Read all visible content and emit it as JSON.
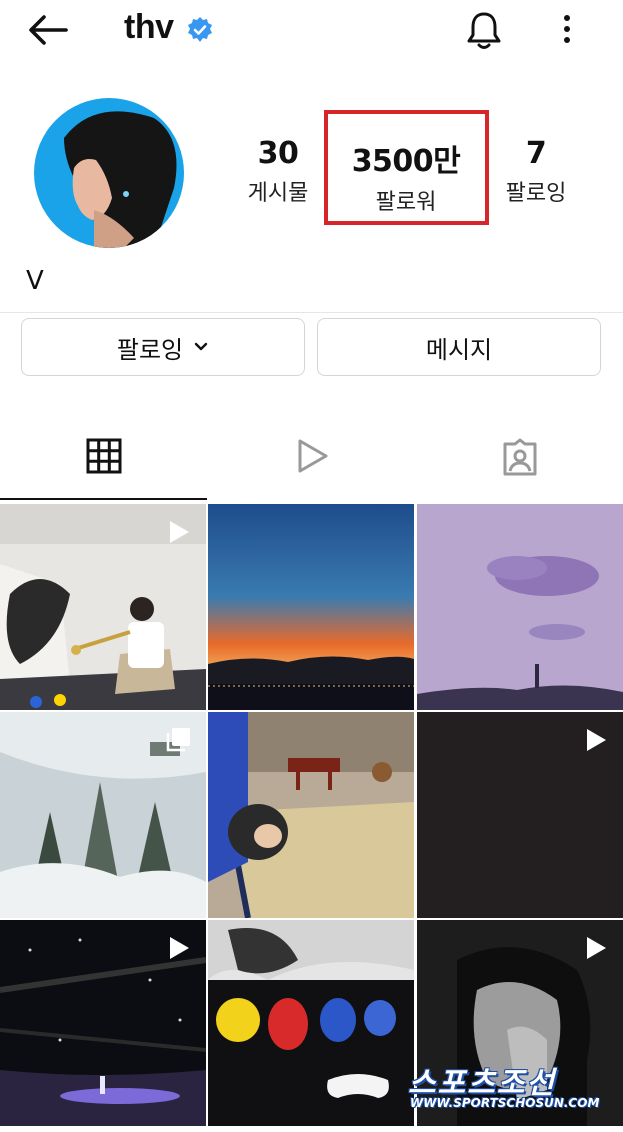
{
  "header": {
    "username": "thv",
    "back_icon": "back-arrow-icon",
    "verified_icon": "verified-badge-icon",
    "notification_icon": "bell-icon",
    "more_icon": "more-vertical-icon",
    "verified_color": "#3897f0"
  },
  "profile": {
    "display_name": "V",
    "avatar_background": "#1aa3e8",
    "stats": {
      "posts": {
        "value": "30",
        "label": "게시물"
      },
      "followers": {
        "value": "3500만",
        "label": "팔로워"
      },
      "following": {
        "value": "7",
        "label": "팔로잉"
      }
    },
    "highlight_color": "#d7262b"
  },
  "actions": {
    "follow_label": "팔로잉",
    "message_label": "메시지"
  },
  "tabs": [
    {
      "icon": "grid-icon",
      "selected": true
    },
    {
      "icon": "reels-play-icon",
      "selected": false
    },
    {
      "icon": "tagged-person-icon",
      "selected": false
    }
  ],
  "posts": [
    {
      "description": "man playing trumpet in living room",
      "badge": "video"
    },
    {
      "description": "sunset over city skyline",
      "badge": "none"
    },
    {
      "description": "purple sky with clouds",
      "badge": "none"
    },
    {
      "description": "snowy forest",
      "badge": "carousel"
    },
    {
      "description": "dog on tatami mat",
      "badge": "none"
    },
    {
      "description": "dark video",
      "badge": "video"
    },
    {
      "description": "concert stage at night",
      "badge": "video"
    },
    {
      "description": "plush toys on sofa",
      "badge": "none"
    },
    {
      "description": "black and white portrait",
      "badge": "video"
    }
  ],
  "watermark": {
    "title": "스포츠조선",
    "url": "WWW.SPORTSCHOSUN.COM"
  }
}
